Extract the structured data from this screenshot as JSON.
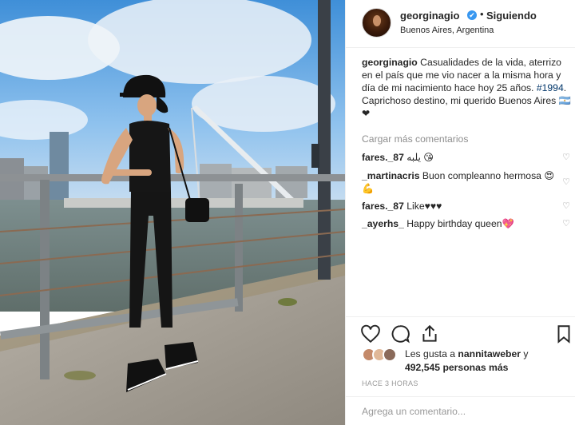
{
  "post": {
    "username": "georginagio",
    "verified_glyph": "✔",
    "separator": "•",
    "follow_label": "Siguiendo",
    "location": "Buenos Aires, Argentina"
  },
  "caption": {
    "username": "georginagio",
    "text_1": "Casualidades de la vida, aterrizo en el país que me vio nacer a la misma hora y día de mi nacimiento hace hoy 25 años.",
    "hashtag": "#1994",
    "text_2": ". Caprichoso destino, mi querido Buenos Aires 🇦🇷 ❤"
  },
  "load_more": "Cargar más comentarios",
  "comments": [
    {
      "user": "fares._87",
      "text": "يلبه 😘"
    },
    {
      "user": "_martinacris",
      "text": "Buon compleanno hermosa 😍💪"
    },
    {
      "user": "fares._87",
      "text": "Like♥♥♥"
    },
    {
      "user": "_ayerhs_",
      "text": "Happy birthday queen💖"
    }
  ],
  "likes": {
    "line_1_prefix": "Les gusta a ",
    "line_1_user": "nannitaweber",
    "line_1_suffix": " y",
    "count": "492,545",
    "line_2_suffix": " personas más"
  },
  "timestamp": "HACE 3 HORAS",
  "add_comment_placeholder": "Agrega un comentario...",
  "icons": {
    "like": "heart-icon",
    "comment": "comment-icon",
    "share": "share-icon",
    "save": "bookmark-icon"
  },
  "colors": {
    "link": "#003569",
    "verified": "#3897f0",
    "muted": "#8e8e8e",
    "text": "#262626"
  }
}
